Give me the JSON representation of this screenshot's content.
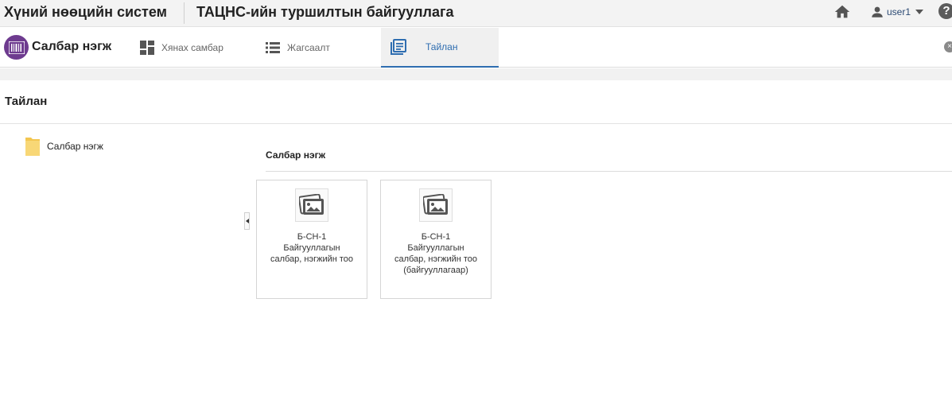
{
  "header": {
    "app_title": "Хүний нөөцийн систем",
    "org_title": "ТАЦНС-ийн туршилтын байгууллага",
    "user_name": "user1",
    "help_label": "?",
    "home_icon": "home-icon",
    "user_icon": "user-icon"
  },
  "nav": {
    "module_name": "Салбар нэгж",
    "tabs": [
      {
        "label": "Хянах самбар",
        "icon": "dashboard-icon",
        "active": false
      },
      {
        "label": "Жагсаалт",
        "icon": "list-icon",
        "active": false
      },
      {
        "label": "Тайлан",
        "icon": "report-icon",
        "active": true
      }
    ],
    "close_label": "×",
    "accent_color": "#2e6db0",
    "module_color": "#6e3b8f"
  },
  "page": {
    "title": "Тайлан"
  },
  "tree": {
    "items": [
      {
        "label": "Салбар нэгж",
        "icon": "folder-icon"
      }
    ]
  },
  "reports": {
    "section_title": "Салбар нэгж",
    "cards": [
      {
        "lines": [
          "Б-СН-1",
          "Байгууллагын",
          "салбар, нэгжийн тоо"
        ],
        "icon": "image-icon"
      },
      {
        "lines": [
          "Б-СН-1",
          "Байгууллагын",
          "салбар, нэгжийн тоо",
          "(байгууллагаар)"
        ],
        "icon": "image-icon"
      }
    ]
  }
}
